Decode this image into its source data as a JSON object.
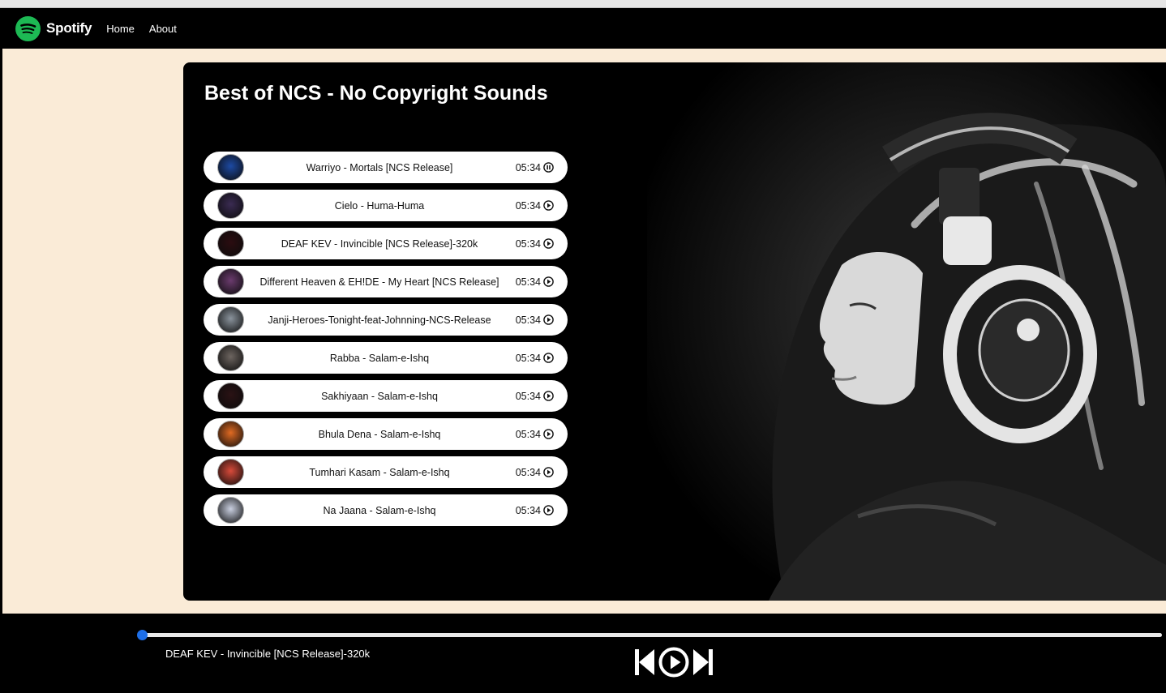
{
  "navbar": {
    "brand": "Spotify",
    "links": [
      "Home",
      "About"
    ]
  },
  "playlist": {
    "title": "Best of NCS - No Copyright Sounds",
    "songs": [
      {
        "name": "Warriyo - Mortals [NCS Release]",
        "duration": "05:34",
        "state": "playing",
        "cover_color": "#1d4aa3"
      },
      {
        "name": "Cielo - Huma-Huma",
        "duration": "05:34",
        "state": "paused",
        "cover_color": "#3a2b52"
      },
      {
        "name": "DEAF KEV - Invincible [NCS Release]-320k",
        "duration": "05:34",
        "state": "paused",
        "cover_color": "#2b0c10"
      },
      {
        "name": "Different Heaven & EH!DE - My Heart [NCS Release]",
        "duration": "05:34",
        "state": "paused",
        "cover_color": "#6b3b6e"
      },
      {
        "name": "Janji-Heroes-Tonight-feat-Johnning-NCS-Release",
        "duration": "05:34",
        "state": "paused",
        "cover_color": "#8a939c"
      },
      {
        "name": "Rabba - Salam-e-Ishq",
        "duration": "05:34",
        "state": "paused",
        "cover_color": "#6d6560"
      },
      {
        "name": "Sakhiyaan - Salam-e-Ishq",
        "duration": "05:34",
        "state": "paused",
        "cover_color": "#2a1214"
      },
      {
        "name": "Bhula Dena - Salam-e-Ishq",
        "duration": "05:34",
        "state": "paused",
        "cover_color": "#e06a22"
      },
      {
        "name": "Tumhari Kasam - Salam-e-Ishq",
        "duration": "05:34",
        "state": "paused",
        "cover_color": "#d84a3a"
      },
      {
        "name": "Na Jaana - Salam-e-Ishq",
        "duration": "05:34",
        "state": "paused",
        "cover_color": "#c9cfe0"
      }
    ]
  },
  "player": {
    "now_playing": "DEAF KEV - Invincible [NCS Release]-320k",
    "progress_fraction": 0.0,
    "accent_color": "#1e6fe8"
  },
  "icons": {
    "logo": "spotify-logo-icon",
    "prev": "step-backward-icon",
    "play": "play-circle-icon",
    "next": "step-forward-icon"
  }
}
